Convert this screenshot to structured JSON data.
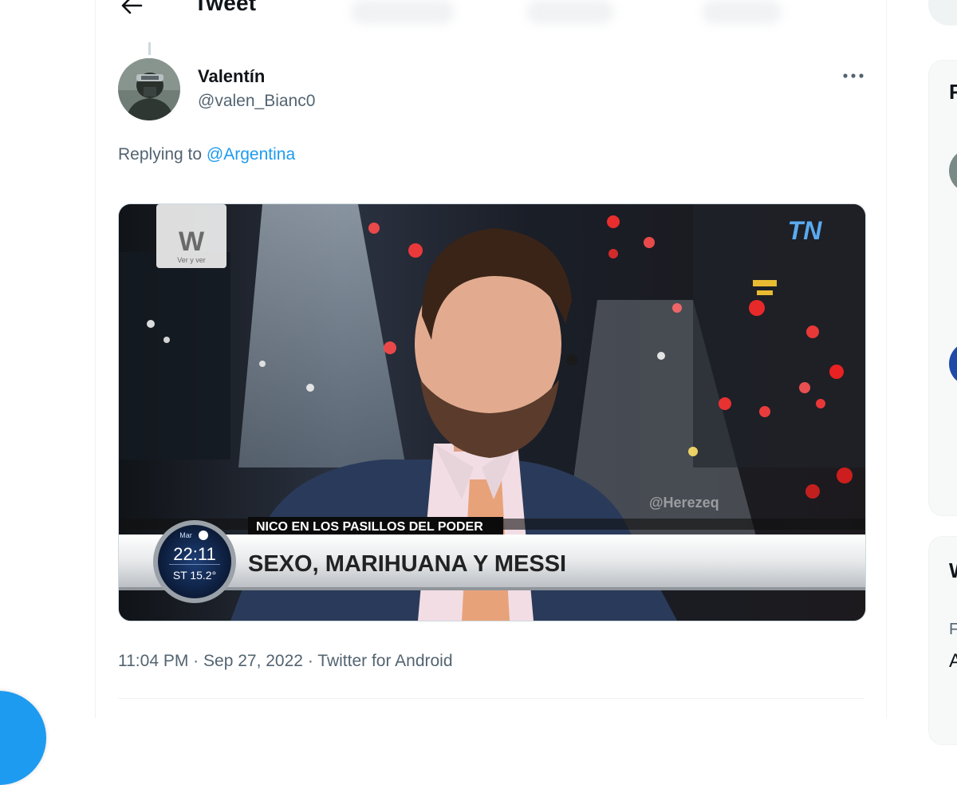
{
  "header": {
    "title": "Tweet"
  },
  "tweet": {
    "author": {
      "display_name": "Valentín",
      "handle": "@valen_Bianc0"
    },
    "replying_prefix": "Replying to",
    "replying_to": "@Argentina",
    "media": {
      "network_logo": "TN",
      "watermark_logo": "W",
      "watermark_small": "Ver y ver",
      "handle_watermark": "@Herezeq",
      "segment_label": "NICO EN LOS PASILLOS DEL PODER",
      "headline": "SEXO, MARIHUANA Y MESSI",
      "clock_time": "22:11",
      "clock_temp": "ST 15.2°",
      "clock_channel": "Mar"
    },
    "time": "11:04 PM",
    "separator": "·",
    "date": "Sep 27, 2022",
    "source": "Twitter for Android"
  },
  "sidebar": {
    "card_initial_1": "F",
    "card_initial_2": "W",
    "small_text_1": "F",
    "small_text_2": "A"
  },
  "icons": {
    "back": "arrow-left-icon",
    "more": "more-horizontal-icon",
    "compose": "compose-fab"
  },
  "colors": {
    "accent": "#1d9bf0",
    "text_primary": "#0f1419",
    "text_secondary": "#536471"
  }
}
